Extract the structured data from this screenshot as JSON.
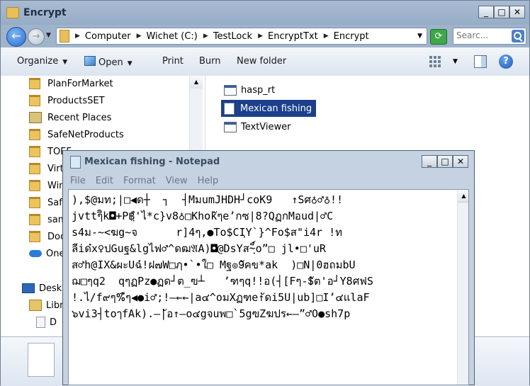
{
  "explorer": {
    "title": "Encrypt",
    "window_buttons": [
      "_",
      "□",
      "✕"
    ],
    "breadcrumb": [
      "Computer",
      "Wichet (C:)",
      "TestLock",
      "EncryptTxt",
      "Encrypt"
    ],
    "search_placeholder": "Searc...",
    "toolbar": {
      "organize": "Organize",
      "open": "Open",
      "print": "Print",
      "burn": "Burn",
      "new_folder": "New folder",
      "help": "?"
    },
    "nav": [
      {
        "label": "PlanForMarket",
        "icon": "folder-icon"
      },
      {
        "label": "ProductsSET",
        "icon": "folder-icon"
      },
      {
        "label": "Recent Places",
        "icon": "recent-places-icon"
      },
      {
        "label": "SafeNetProducts",
        "icon": "folder-icon"
      },
      {
        "label": "TOEF",
        "icon": "folder-icon"
      },
      {
        "label": "Virt",
        "icon": "folder-icon"
      },
      {
        "label": "Win",
        "icon": "folder-icon"
      },
      {
        "label": "Safe",
        "icon": "folder-icon"
      },
      {
        "label": "sam",
        "icon": "folder-icon"
      },
      {
        "label": "Doc",
        "icon": "folder-icon"
      },
      {
        "label": "One",
        "icon": "onedrive-icon"
      },
      {
        "label": "Desk",
        "icon": "desktop-icon"
      },
      {
        "label": "Libr",
        "icon": "libraries-icon"
      },
      {
        "label": "D",
        "icon": "documents-icon"
      }
    ],
    "files": [
      {
        "label": "hasp_rt",
        "icon": "application-icon",
        "selected": false
      },
      {
        "label": "Mexican fishing",
        "icon": "text-file-icon",
        "selected": true
      },
      {
        "label": "TextViewer",
        "icon": "application-icon",
        "selected": false
      }
    ]
  },
  "notepad": {
    "title": "Mexican fishing - Notepad",
    "window_buttons": [
      "_",
      "□",
      "✕"
    ],
    "menu": [
      "File",
      "Edit",
      "Format",
      "View",
      "Help"
    ],
    "lines": [
      "),$@มท;|□◀ด┼  ┐  ┤MมumJHDH┘coK9   ↑Sศ♁♂♁!!",
      "jvttๆ̃ิk◘+P฿ฺํ'ไ*c}v8♁□Khokัๆe’กซ|8?QฏกMอud|♂C",
      "s4ม-~<ฆg~จ      r]4ๆ,●To$CIฺY`}^Fo$ส\"i4r !ท",
      "ลีiด๋x♀ปGuฐ&lgไฟ♂^ดฒ𝔄A)◘@DsYส~ฺ็์o”□ jl•□'uR",
      "ส♂h@IX&ผะUฉ๋!ฝ๗W□ฦ•`•ใ□ Mฐ๏9ัคข*ak  )□N|0ฮถมbU",
      "ฌ□ๆq2  qๆฏPz●ฏด┘ต_ฃ┴   ’ฑๆq!!อ(┤[Fๆ-$ัต'อ┘Y8ศฟS",
      "!.ไ/f๙ๆ%ืๆ◀●i♂;!—←←|a๔^oมXฏฑe↑ัดi5U|ub]□I’๔แlaF",
      "๖vi3┤toๅfAk).—|ัอ↑—o๔gจuพ□`5gฃZฆปร←—”♂O●sh7p"
    ]
  }
}
